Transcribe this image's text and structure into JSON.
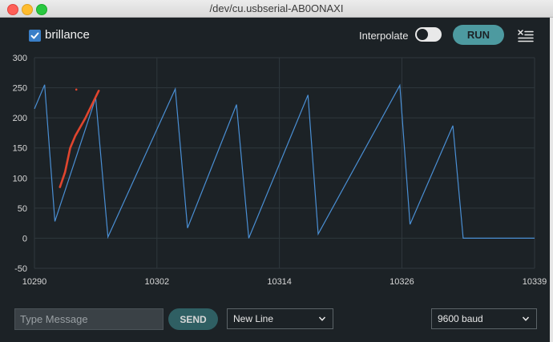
{
  "window": {
    "title": "/dev/cu.usbserial-AB0ONAXI"
  },
  "toolbar": {
    "series_checkbox_label": "brillance",
    "series_checked": true,
    "interpolate_label": "Interpolate",
    "interpolate_on": false,
    "run_label": "RUN",
    "icons": {
      "checkbox": "checkbox-checked-icon",
      "clear": "clear-list-icon"
    }
  },
  "colors": {
    "series": "#4a8fd4",
    "annotation": "#e0452e",
    "accent": "#4d9aa0",
    "background": "#1c2226"
  },
  "chart_data": {
    "type": "line",
    "xlabel": "",
    "ylabel": "",
    "xlim": [
      10290,
      10339
    ],
    "ylim": [
      -50,
      300
    ],
    "x_ticks": [
      "10290",
      "10302",
      "10314",
      "10326",
      "10339"
    ],
    "y_ticks": [
      "300",
      "250",
      "200",
      "150",
      "100",
      "50",
      "0",
      "-50"
    ],
    "grid": true,
    "series": [
      {
        "name": "brillance",
        "x": [
          10290,
          10291,
          10292,
          10296,
          10297.2,
          10303.8,
          10305,
          10309.8,
          10311,
          10316.8,
          10317.8,
          10325.8,
          10326.8,
          10331,
          10332,
          10339
        ],
        "y": [
          215,
          255,
          28,
          233,
          2,
          248,
          17,
          222,
          0,
          238,
          7,
          254,
          23,
          187,
          0,
          0
        ]
      }
    ],
    "annotations": [
      {
        "type": "freehand-stroke",
        "x": [
          10292.5,
          10293,
          10293.5,
          10294,
          10295,
          10296.3
        ],
        "y": [
          85,
          110,
          150,
          170,
          200,
          245
        ]
      },
      {
        "type": "dot",
        "x": [
          10294.1
        ],
        "y": [
          247
        ]
      }
    ]
  },
  "footer": {
    "message_placeholder": "Type Message",
    "message_value": "",
    "send_label": "SEND",
    "line_ending": "New Line",
    "baud_rate": "9600 baud"
  }
}
